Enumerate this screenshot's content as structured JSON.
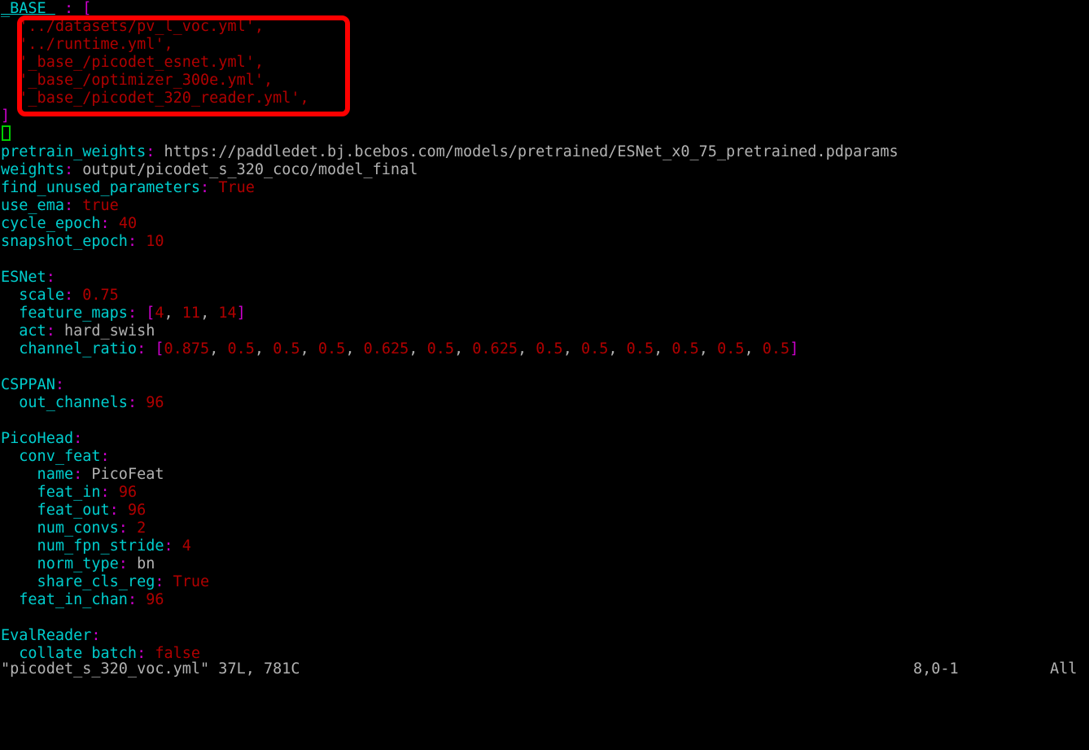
{
  "editor": {
    "name": "vim",
    "background": "#000000",
    "foreground": "#b2b2b2",
    "colors": {
      "key": "#00cdcd",
      "punctuation": "#cd00cd",
      "number": "#b00000",
      "string": "#b00000",
      "plain": "#b2b2b2",
      "cursor": "#00cd00",
      "annotation": "#fe0000"
    }
  },
  "annotation": {
    "shape": "rounded-rectangle",
    "color": "#fe0000",
    "covers_lines": "2-6",
    "note": "red box highlighting the _BASE_ include list"
  },
  "cursor": {
    "line": 8,
    "column": 1,
    "style": "hollow-block"
  },
  "lines": [
    {
      "num": 1,
      "tokens": [
        {
          "t": "_BASE_",
          "c": "ku"
        },
        {
          "t": " : ",
          "c": "p"
        },
        {
          "t": "[",
          "c": "p"
        }
      ]
    },
    {
      "num": 2,
      "tokens": [
        {
          "t": "  '../datasets/pv_l_voc.yml',",
          "c": "str"
        }
      ]
    },
    {
      "num": 3,
      "tokens": [
        {
          "t": "  '../runtime.yml',",
          "c": "str"
        }
      ]
    },
    {
      "num": 4,
      "tokens": [
        {
          "t": "  '_base_/picodet_esnet.yml',",
          "c": "str"
        }
      ]
    },
    {
      "num": 5,
      "tokens": [
        {
          "t": "  '_base_/optimizer_300e.yml',",
          "c": "str"
        }
      ]
    },
    {
      "num": 6,
      "tokens": [
        {
          "t": "  '_base_/picodet_320_reader.yml',",
          "c": "str"
        }
      ]
    },
    {
      "num": 7,
      "tokens": [
        {
          "t": "]",
          "c": "p"
        }
      ]
    },
    {
      "num": 8,
      "tokens": [
        {
          "t": " ",
          "c": "plain"
        }
      ]
    },
    {
      "num": 9,
      "tokens": [
        {
          "t": "pretrain_weights",
          "c": "k"
        },
        {
          "t": ":",
          "c": "p"
        },
        {
          "t": " https://paddledet.bj.bcebos.com/models/pretrained/ESNet_x0_75_pretrained.pdparams",
          "c": "s"
        }
      ]
    },
    {
      "num": 10,
      "tokens": [
        {
          "t": "weights",
          "c": "k"
        },
        {
          "t": ":",
          "c": "p"
        },
        {
          "t": " output/picodet_s_320_coco/model_final",
          "c": "s"
        }
      ]
    },
    {
      "num": 11,
      "tokens": [
        {
          "t": "find_unused_parameters",
          "c": "k"
        },
        {
          "t": ":",
          "c": "p"
        },
        {
          "t": " ",
          "c": "plain"
        },
        {
          "t": "True",
          "c": "n"
        }
      ]
    },
    {
      "num": 12,
      "tokens": [
        {
          "t": "use_ema",
          "c": "k"
        },
        {
          "t": ":",
          "c": "p"
        },
        {
          "t": " ",
          "c": "plain"
        },
        {
          "t": "true",
          "c": "n"
        }
      ]
    },
    {
      "num": 13,
      "tokens": [
        {
          "t": "cycle_epoch",
          "c": "k"
        },
        {
          "t": ":",
          "c": "p"
        },
        {
          "t": " ",
          "c": "plain"
        },
        {
          "t": "40",
          "c": "n"
        }
      ]
    },
    {
      "num": 14,
      "tokens": [
        {
          "t": "snapshot_epoch",
          "c": "k"
        },
        {
          "t": ":",
          "c": "p"
        },
        {
          "t": " ",
          "c": "plain"
        },
        {
          "t": "10",
          "c": "n"
        }
      ]
    },
    {
      "num": 15,
      "tokens": [
        {
          "t": " ",
          "c": "plain"
        }
      ]
    },
    {
      "num": 16,
      "tokens": [
        {
          "t": "ESNet",
          "c": "k"
        },
        {
          "t": ":",
          "c": "p"
        }
      ]
    },
    {
      "num": 17,
      "tokens": [
        {
          "t": "  scale",
          "c": "k"
        },
        {
          "t": ":",
          "c": "p"
        },
        {
          "t": " ",
          "c": "plain"
        },
        {
          "t": "0.75",
          "c": "n"
        }
      ]
    },
    {
      "num": 18,
      "tokens": [
        {
          "t": "  feature_maps",
          "c": "k"
        },
        {
          "t": ":",
          "c": "p"
        },
        {
          "t": " ",
          "c": "plain"
        },
        {
          "t": "[",
          "c": "p"
        },
        {
          "t": "4",
          "c": "n"
        },
        {
          "t": ", ",
          "c": "plain"
        },
        {
          "t": "11",
          "c": "n"
        },
        {
          "t": ", ",
          "c": "plain"
        },
        {
          "t": "14",
          "c": "n"
        },
        {
          "t": "]",
          "c": "p"
        }
      ]
    },
    {
      "num": 19,
      "tokens": [
        {
          "t": "  act",
          "c": "k"
        },
        {
          "t": ":",
          "c": "p"
        },
        {
          "t": " hard_swish",
          "c": "s"
        }
      ]
    },
    {
      "num": 20,
      "tokens": [
        {
          "t": "  channel_ratio",
          "c": "k"
        },
        {
          "t": ":",
          "c": "p"
        },
        {
          "t": " ",
          "c": "plain"
        },
        {
          "t": "[",
          "c": "p"
        },
        {
          "t": "0.875",
          "c": "n"
        },
        {
          "t": ", ",
          "c": "plain"
        },
        {
          "t": "0.5",
          "c": "n"
        },
        {
          "t": ", ",
          "c": "plain"
        },
        {
          "t": "0.5",
          "c": "n"
        },
        {
          "t": ", ",
          "c": "plain"
        },
        {
          "t": "0.5",
          "c": "n"
        },
        {
          "t": ", ",
          "c": "plain"
        },
        {
          "t": "0.625",
          "c": "n"
        },
        {
          "t": ", ",
          "c": "plain"
        },
        {
          "t": "0.5",
          "c": "n"
        },
        {
          "t": ", ",
          "c": "plain"
        },
        {
          "t": "0.625",
          "c": "n"
        },
        {
          "t": ", ",
          "c": "plain"
        },
        {
          "t": "0.5",
          "c": "n"
        },
        {
          "t": ", ",
          "c": "plain"
        },
        {
          "t": "0.5",
          "c": "n"
        },
        {
          "t": ", ",
          "c": "plain"
        },
        {
          "t": "0.5",
          "c": "n"
        },
        {
          "t": ", ",
          "c": "plain"
        },
        {
          "t": "0.5",
          "c": "n"
        },
        {
          "t": ", ",
          "c": "plain"
        },
        {
          "t": "0.5",
          "c": "n"
        },
        {
          "t": ", ",
          "c": "plain"
        },
        {
          "t": "0.5",
          "c": "n"
        },
        {
          "t": "]",
          "c": "p"
        }
      ]
    },
    {
      "num": 21,
      "tokens": [
        {
          "t": " ",
          "c": "plain"
        }
      ]
    },
    {
      "num": 22,
      "tokens": [
        {
          "t": "CSPPAN",
          "c": "k"
        },
        {
          "t": ":",
          "c": "p"
        }
      ]
    },
    {
      "num": 23,
      "tokens": [
        {
          "t": "  out_channels",
          "c": "k"
        },
        {
          "t": ":",
          "c": "p"
        },
        {
          "t": " ",
          "c": "plain"
        },
        {
          "t": "96",
          "c": "n"
        }
      ]
    },
    {
      "num": 24,
      "tokens": [
        {
          "t": " ",
          "c": "plain"
        }
      ]
    },
    {
      "num": 25,
      "tokens": [
        {
          "t": "PicoHead",
          "c": "k"
        },
        {
          "t": ":",
          "c": "p"
        }
      ]
    },
    {
      "num": 26,
      "tokens": [
        {
          "t": "  conv_feat",
          "c": "k"
        },
        {
          "t": ":",
          "c": "p"
        }
      ]
    },
    {
      "num": 27,
      "tokens": [
        {
          "t": "    name",
          "c": "k"
        },
        {
          "t": ":",
          "c": "p"
        },
        {
          "t": " PicoFeat",
          "c": "s"
        }
      ]
    },
    {
      "num": 28,
      "tokens": [
        {
          "t": "    feat_in",
          "c": "k"
        },
        {
          "t": ":",
          "c": "p"
        },
        {
          "t": " ",
          "c": "plain"
        },
        {
          "t": "96",
          "c": "n"
        }
      ]
    },
    {
      "num": 29,
      "tokens": [
        {
          "t": "    feat_out",
          "c": "k"
        },
        {
          "t": ":",
          "c": "p"
        },
        {
          "t": " ",
          "c": "plain"
        },
        {
          "t": "96",
          "c": "n"
        }
      ]
    },
    {
      "num": 30,
      "tokens": [
        {
          "t": "    num_convs",
          "c": "k"
        },
        {
          "t": ":",
          "c": "p"
        },
        {
          "t": " ",
          "c": "plain"
        },
        {
          "t": "2",
          "c": "n"
        }
      ]
    },
    {
      "num": 31,
      "tokens": [
        {
          "t": "    num_fpn_stride",
          "c": "k"
        },
        {
          "t": ":",
          "c": "p"
        },
        {
          "t": " ",
          "c": "plain"
        },
        {
          "t": "4",
          "c": "n"
        }
      ]
    },
    {
      "num": 32,
      "tokens": [
        {
          "t": "    norm_type",
          "c": "k"
        },
        {
          "t": ":",
          "c": "p"
        },
        {
          "t": " bn",
          "c": "s"
        }
      ]
    },
    {
      "num": 33,
      "tokens": [
        {
          "t": "    share_cls_reg",
          "c": "k"
        },
        {
          "t": ":",
          "c": "p"
        },
        {
          "t": " ",
          "c": "plain"
        },
        {
          "t": "True",
          "c": "n"
        }
      ]
    },
    {
      "num": 34,
      "tokens": [
        {
          "t": "  feat_in_chan",
          "c": "k"
        },
        {
          "t": ":",
          "c": "p"
        },
        {
          "t": " ",
          "c": "plain"
        },
        {
          "t": "96",
          "c": "n"
        }
      ]
    },
    {
      "num": 35,
      "tokens": [
        {
          "t": " ",
          "c": "plain"
        }
      ]
    },
    {
      "num": 36,
      "tokens": [
        {
          "t": "EvalReader",
          "c": "k"
        },
        {
          "t": ":",
          "c": "p"
        }
      ]
    },
    {
      "num": 37,
      "tokens": [
        {
          "t": "  collate_batch",
          "c": "k"
        },
        {
          "t": ":",
          "c": "p"
        },
        {
          "t": " ",
          "c": "plain"
        },
        {
          "t": "false",
          "c": "n"
        }
      ]
    }
  ],
  "statusline": {
    "file": "\"picodet_s_320_voc.yml\" 37L, 781C",
    "position": "8,0-1",
    "percent": "All"
  }
}
